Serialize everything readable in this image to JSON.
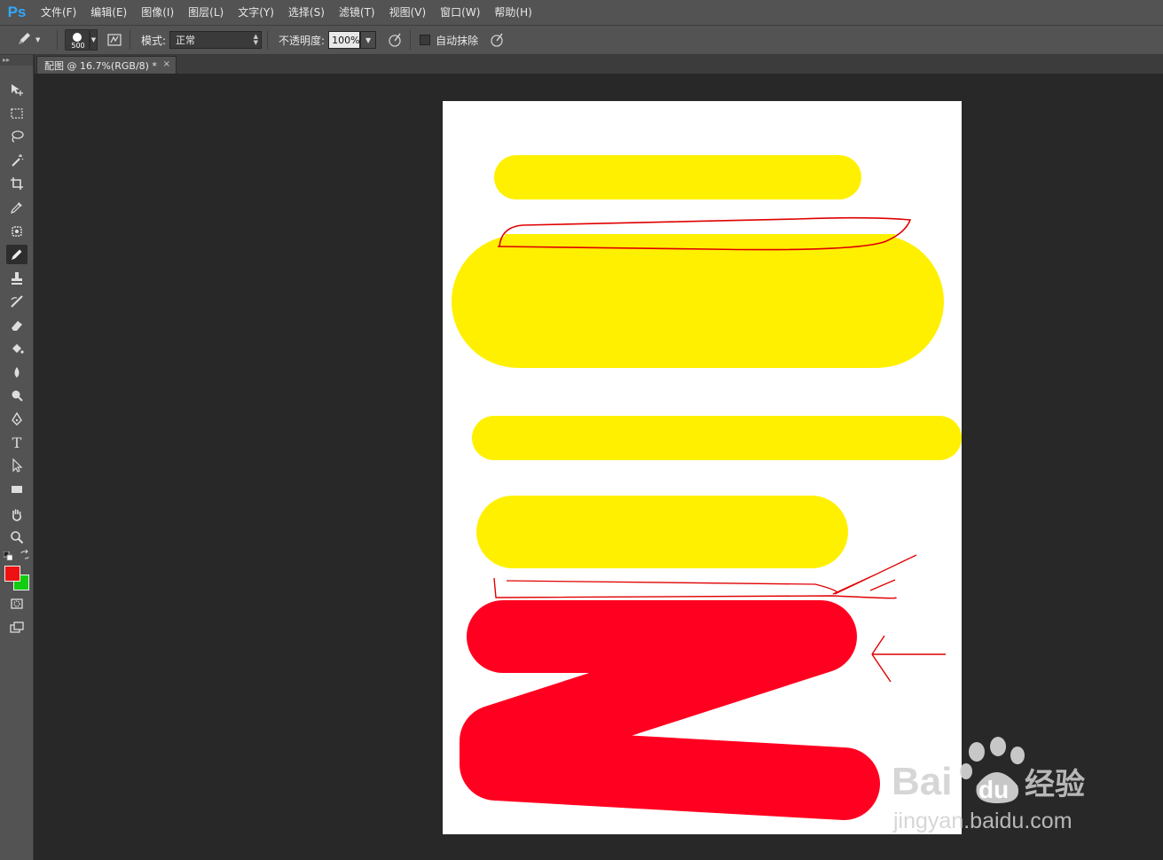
{
  "app": {
    "logo": "Ps"
  },
  "menu": [
    {
      "label": "文件(F)"
    },
    {
      "label": "编辑(E)"
    },
    {
      "label": "图像(I)"
    },
    {
      "label": "图层(L)"
    },
    {
      "label": "文字(Y)"
    },
    {
      "label": "选择(S)"
    },
    {
      "label": "滤镜(T)"
    },
    {
      "label": "视图(V)"
    },
    {
      "label": "窗口(W)"
    },
    {
      "label": "帮助(H)"
    }
  ],
  "options": {
    "brush_size": "500",
    "mode_label": "模式:",
    "mode_value": "正常",
    "opacity_label": "不透明度:",
    "opacity_value": "100%",
    "auto_erase_label": "自动抹除"
  },
  "document": {
    "tab_title": "配图 @ 16.7%(RGB/8) *",
    "close_glyph": "×"
  },
  "colors": {
    "foreground": "#ee1111",
    "background": "#11cc11",
    "yellow_stroke": "#fff000",
    "red_stroke": "#ff0020"
  },
  "tools": [
    {
      "name": "move-tool",
      "icon": "move-icon"
    },
    {
      "name": "marquee-tool",
      "icon": "marquee-icon"
    },
    {
      "name": "lasso-tool",
      "icon": "lasso-icon"
    },
    {
      "name": "magic-wand-tool",
      "icon": "magic-wand-icon"
    },
    {
      "name": "crop-tool",
      "icon": "crop-icon"
    },
    {
      "name": "eyedropper-tool",
      "icon": "eyedropper-icon"
    },
    {
      "name": "healing-brush-tool",
      "icon": "bandage-icon"
    },
    {
      "name": "pencil-tool",
      "icon": "pencil-icon",
      "active": true
    },
    {
      "name": "stamp-tool",
      "icon": "stamp-icon"
    },
    {
      "name": "history-brush-tool",
      "icon": "history-brush-icon"
    },
    {
      "name": "eraser-tool",
      "icon": "eraser-icon"
    },
    {
      "name": "paint-bucket-tool",
      "icon": "bucket-icon"
    },
    {
      "name": "blur-tool",
      "icon": "drop-icon"
    },
    {
      "name": "dodge-tool",
      "icon": "dodge-icon"
    },
    {
      "name": "pen-tool",
      "icon": "pen-icon"
    },
    {
      "name": "type-tool",
      "icon": "type-icon",
      "glyph": "T"
    },
    {
      "name": "path-selection-tool",
      "icon": "arrow-icon"
    },
    {
      "name": "rectangle-tool",
      "icon": "rectangle-icon"
    },
    {
      "name": "hand-tool",
      "icon": "hand-icon"
    },
    {
      "name": "zoom-tool",
      "icon": "zoom-icon"
    }
  ],
  "watermark": {
    "brand": "Bai",
    "brand2": "du",
    "product": "经验",
    "url": "jingyan.baidu.com"
  }
}
